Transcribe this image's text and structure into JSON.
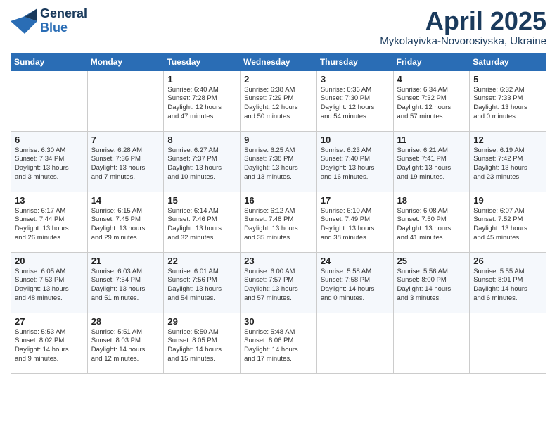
{
  "header": {
    "logo_line1": "General",
    "logo_line2": "Blue",
    "month": "April 2025",
    "location": "Mykolayivka-Novorosiyska, Ukraine"
  },
  "weekdays": [
    "Sunday",
    "Monday",
    "Tuesday",
    "Wednesday",
    "Thursday",
    "Friday",
    "Saturday"
  ],
  "weeks": [
    [
      {
        "day": "",
        "info": ""
      },
      {
        "day": "",
        "info": ""
      },
      {
        "day": "1",
        "info": "Sunrise: 6:40 AM\nSunset: 7:28 PM\nDaylight: 12 hours\nand 47 minutes."
      },
      {
        "day": "2",
        "info": "Sunrise: 6:38 AM\nSunset: 7:29 PM\nDaylight: 12 hours\nand 50 minutes."
      },
      {
        "day": "3",
        "info": "Sunrise: 6:36 AM\nSunset: 7:30 PM\nDaylight: 12 hours\nand 54 minutes."
      },
      {
        "day": "4",
        "info": "Sunrise: 6:34 AM\nSunset: 7:32 PM\nDaylight: 12 hours\nand 57 minutes."
      },
      {
        "day": "5",
        "info": "Sunrise: 6:32 AM\nSunset: 7:33 PM\nDaylight: 13 hours\nand 0 minutes."
      }
    ],
    [
      {
        "day": "6",
        "info": "Sunrise: 6:30 AM\nSunset: 7:34 PM\nDaylight: 13 hours\nand 3 minutes."
      },
      {
        "day": "7",
        "info": "Sunrise: 6:28 AM\nSunset: 7:36 PM\nDaylight: 13 hours\nand 7 minutes."
      },
      {
        "day": "8",
        "info": "Sunrise: 6:27 AM\nSunset: 7:37 PM\nDaylight: 13 hours\nand 10 minutes."
      },
      {
        "day": "9",
        "info": "Sunrise: 6:25 AM\nSunset: 7:38 PM\nDaylight: 13 hours\nand 13 minutes."
      },
      {
        "day": "10",
        "info": "Sunrise: 6:23 AM\nSunset: 7:40 PM\nDaylight: 13 hours\nand 16 minutes."
      },
      {
        "day": "11",
        "info": "Sunrise: 6:21 AM\nSunset: 7:41 PM\nDaylight: 13 hours\nand 19 minutes."
      },
      {
        "day": "12",
        "info": "Sunrise: 6:19 AM\nSunset: 7:42 PM\nDaylight: 13 hours\nand 23 minutes."
      }
    ],
    [
      {
        "day": "13",
        "info": "Sunrise: 6:17 AM\nSunset: 7:44 PM\nDaylight: 13 hours\nand 26 minutes."
      },
      {
        "day": "14",
        "info": "Sunrise: 6:15 AM\nSunset: 7:45 PM\nDaylight: 13 hours\nand 29 minutes."
      },
      {
        "day": "15",
        "info": "Sunrise: 6:14 AM\nSunset: 7:46 PM\nDaylight: 13 hours\nand 32 minutes."
      },
      {
        "day": "16",
        "info": "Sunrise: 6:12 AM\nSunset: 7:48 PM\nDaylight: 13 hours\nand 35 minutes."
      },
      {
        "day": "17",
        "info": "Sunrise: 6:10 AM\nSunset: 7:49 PM\nDaylight: 13 hours\nand 38 minutes."
      },
      {
        "day": "18",
        "info": "Sunrise: 6:08 AM\nSunset: 7:50 PM\nDaylight: 13 hours\nand 41 minutes."
      },
      {
        "day": "19",
        "info": "Sunrise: 6:07 AM\nSunset: 7:52 PM\nDaylight: 13 hours\nand 45 minutes."
      }
    ],
    [
      {
        "day": "20",
        "info": "Sunrise: 6:05 AM\nSunset: 7:53 PM\nDaylight: 13 hours\nand 48 minutes."
      },
      {
        "day": "21",
        "info": "Sunrise: 6:03 AM\nSunset: 7:54 PM\nDaylight: 13 hours\nand 51 minutes."
      },
      {
        "day": "22",
        "info": "Sunrise: 6:01 AM\nSunset: 7:56 PM\nDaylight: 13 hours\nand 54 minutes."
      },
      {
        "day": "23",
        "info": "Sunrise: 6:00 AM\nSunset: 7:57 PM\nDaylight: 13 hours\nand 57 minutes."
      },
      {
        "day": "24",
        "info": "Sunrise: 5:58 AM\nSunset: 7:58 PM\nDaylight: 14 hours\nand 0 minutes."
      },
      {
        "day": "25",
        "info": "Sunrise: 5:56 AM\nSunset: 8:00 PM\nDaylight: 14 hours\nand 3 minutes."
      },
      {
        "day": "26",
        "info": "Sunrise: 5:55 AM\nSunset: 8:01 PM\nDaylight: 14 hours\nand 6 minutes."
      }
    ],
    [
      {
        "day": "27",
        "info": "Sunrise: 5:53 AM\nSunset: 8:02 PM\nDaylight: 14 hours\nand 9 minutes."
      },
      {
        "day": "28",
        "info": "Sunrise: 5:51 AM\nSunset: 8:03 PM\nDaylight: 14 hours\nand 12 minutes."
      },
      {
        "day": "29",
        "info": "Sunrise: 5:50 AM\nSunset: 8:05 PM\nDaylight: 14 hours\nand 15 minutes."
      },
      {
        "day": "30",
        "info": "Sunrise: 5:48 AM\nSunset: 8:06 PM\nDaylight: 14 hours\nand 17 minutes."
      },
      {
        "day": "",
        "info": ""
      },
      {
        "day": "",
        "info": ""
      },
      {
        "day": "",
        "info": ""
      }
    ]
  ]
}
